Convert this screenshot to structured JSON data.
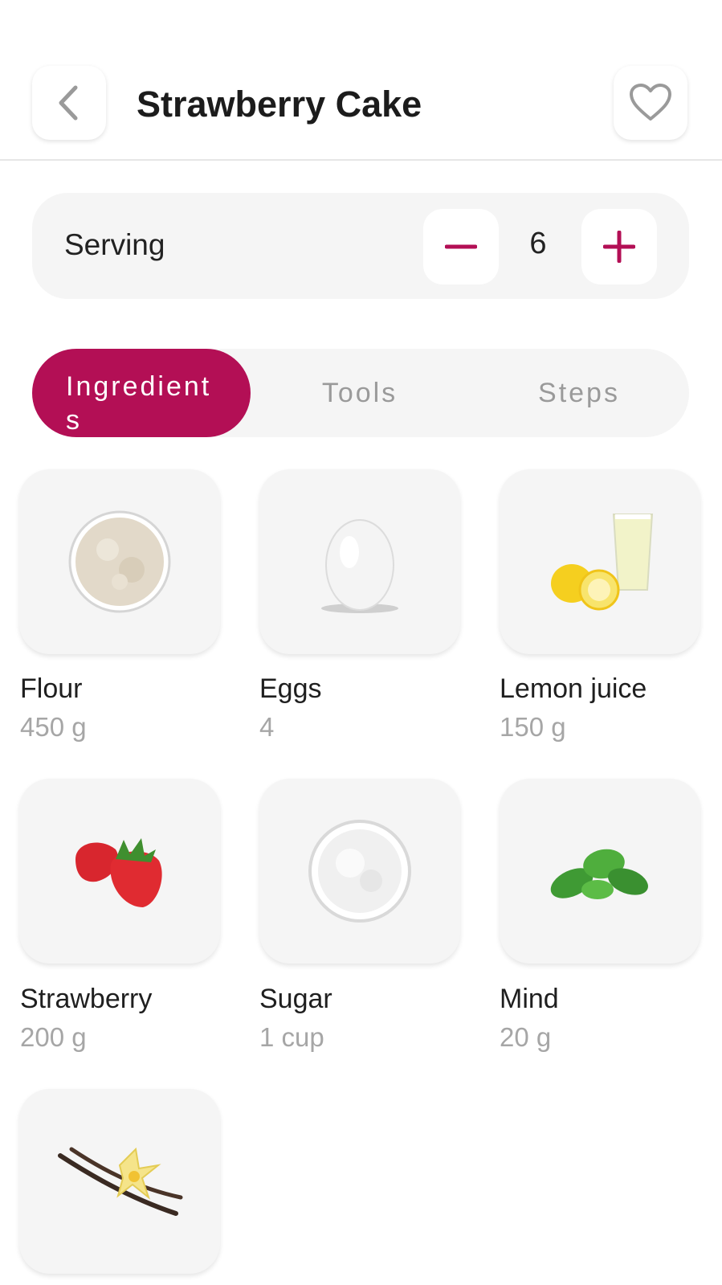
{
  "header": {
    "title": "Strawberry Cake",
    "back_icon": "chevron-left-icon",
    "favorite_icon": "heart-outline-icon"
  },
  "serving": {
    "label": "Serving",
    "count": "6",
    "decrement_icon": "minus-icon",
    "increment_icon": "plus-icon"
  },
  "tabs": [
    {
      "label": "Ingredients",
      "active": true
    },
    {
      "label": "Tools",
      "active": false
    },
    {
      "label": "Steps",
      "active": false
    }
  ],
  "ingredients": [
    {
      "name": "Flour",
      "qty": "450 g",
      "image": "flour-bowl-image"
    },
    {
      "name": "Eggs",
      "qty": "4",
      "image": "egg-image"
    },
    {
      "name": "Lemon juice",
      "qty": "150 g",
      "image": "lemon-juice-image"
    },
    {
      "name": "Strawberry",
      "qty": "200 g",
      "image": "strawberry-image"
    },
    {
      "name": "Sugar",
      "qty": "1 cup",
      "image": "sugar-bowl-image"
    },
    {
      "name": "Mind",
      "qty": "20 g",
      "image": "mint-leaves-image"
    },
    {
      "image": "vanilla-image"
    }
  ],
  "colors": {
    "accent": "#b30f55",
    "card_bg": "#f5f5f5",
    "muted_text": "#a6a6a6",
    "tab_inactive_text": "#9a9a9a"
  }
}
